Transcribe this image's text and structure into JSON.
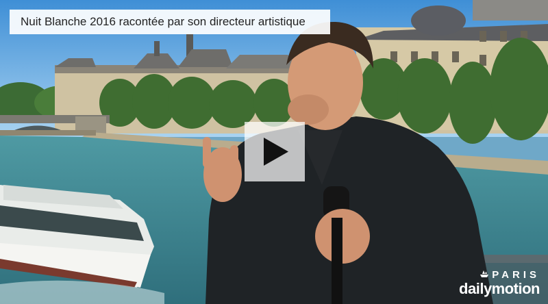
{
  "video": {
    "title": "Nuit Blanche 2016 racontée par son directeur artistique"
  },
  "overlay": {
    "play_icon": "play-icon",
    "city_label": "PARIS",
    "platform_logo": "dailymotion",
    "colors": {
      "overlay_bg": "#ffffff",
      "play_triangle": "#111111",
      "logo": "#ffffff"
    }
  }
}
